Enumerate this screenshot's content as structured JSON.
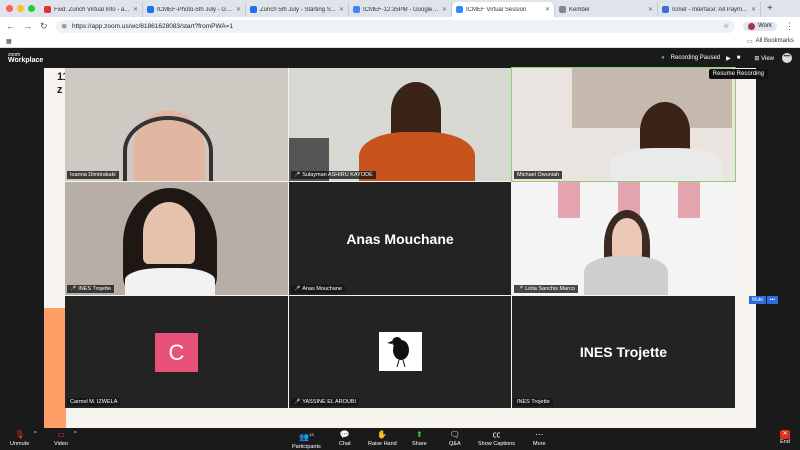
{
  "browser": {
    "tabs": [
      {
        "title": "Fwd: Zurich Virtual Info - a...",
        "color": "#d33"
      },
      {
        "title": "ICMEF-Photo-5th July - Go...",
        "color": "#1a73e8"
      },
      {
        "title": "Zurich 5th July - Starting S...",
        "color": "#1a73e8"
      },
      {
        "title": "ICMEF-12:35PM - Google D...",
        "color": "#4285f4"
      },
      {
        "title": "ICMEF Virtual Session",
        "color": "#2d8cff"
      },
      {
        "title": "Kembel",
        "color": "#888"
      },
      {
        "title": "Icmef - Interface: All Paym...",
        "color": "#3a6fd8"
      }
    ],
    "url": "https://app.zoom.us/wc/81861628083/start?fromPWA=1",
    "profile": "Work",
    "bookmarks_label": "All Bookmarks"
  },
  "zoom": {
    "brand_top": "zoom",
    "brand_bottom": "Workplace",
    "recording_status": "Recording Paused",
    "view_label": "View",
    "resume_tooltip": "Resume Recording",
    "slide_text": "11\nZ",
    "mute_label": "Mute",
    "participants": [
      {
        "name": "Ioanna Dimitrakaki",
        "muted": false
      },
      {
        "name": "Sulayman ASHIRU KAYODE",
        "muted": true
      },
      {
        "name": "Michael Owuniah",
        "muted": false
      },
      {
        "name": "INES Trojette",
        "muted": true
      },
      {
        "name": "Anas Mouchane",
        "muted": true,
        "display": "Anas Mouchane"
      },
      {
        "name": "Lidia Sanchis Marco",
        "muted": true
      },
      {
        "name": "Carmel M. IZWELA",
        "muted": false,
        "initial": "C"
      },
      {
        "name": "YASSINE EL AROUBI",
        "muted": true
      },
      {
        "name": "INES Trojette",
        "muted": false,
        "display": "INES Trojette"
      }
    ],
    "toolbar": {
      "unmute": "Unmute",
      "video": "Video",
      "participants": "Participants",
      "participants_count": "13",
      "chat": "Chat",
      "raise_hand": "Raise Hand",
      "share": "Share",
      "qa": "Q&A",
      "captions": "Show Captions",
      "more": "More",
      "end": "End"
    }
  }
}
